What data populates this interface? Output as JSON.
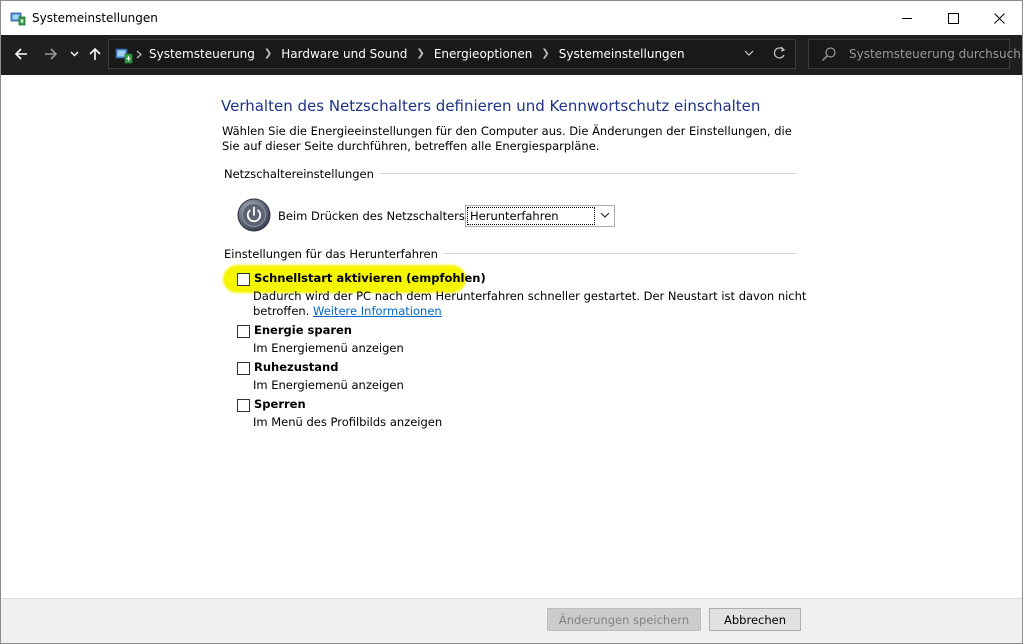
{
  "window": {
    "title": "Systemeinstellungen"
  },
  "address_bar": {
    "breadcrumbs": [
      "Systemsteuerung",
      "Hardware und Sound",
      "Energieoptionen",
      "Systemeinstellungen"
    ],
    "search_placeholder": "Systemsteuerung durchsuch..."
  },
  "page": {
    "title": "Verhalten des Netzschalters definieren und Kennwortschutz einschalten",
    "intro": "Wählen Sie die Energieeinstellungen für den Computer aus. Die Änderungen der Einstellungen, die Sie auf dieser Seite durchführen, betreffen alle Energiesparpläne."
  },
  "power_button_settings": {
    "group_label": "Netzschaltereinstellungen",
    "label": "Beim Drücken des Netzschalters:",
    "selected": "Herunterfahren"
  },
  "shutdown_settings": {
    "group_label": "Einstellungen für das Herunterfahren",
    "options": [
      {
        "title": "Schnellstart aktivieren (empfohlen)",
        "desc_line1": "Dadurch wird der PC nach dem Herunterfahren schneller gestartet. Der Neustart ist davon nicht",
        "desc_line2_prefix": "betroffen.",
        "link": "Weitere Informationen",
        "checked": false,
        "highlighted": true
      },
      {
        "title": "Energie sparen",
        "desc": "Im Energiemenü anzeigen",
        "checked": false
      },
      {
        "title": "Ruhezustand",
        "desc": "Im Energiemenü anzeigen",
        "checked": false
      },
      {
        "title": "Sperren",
        "desc": "Im Menü des Profilbilds anzeigen",
        "checked": false
      }
    ]
  },
  "footer": {
    "save_label": "Änderungen speichern",
    "cancel_label": "Abbrechen"
  },
  "colors": {
    "title_blue": "#1e3287",
    "link_blue": "#0066cc",
    "highlight_yellow": "#f5f500",
    "address_bar_bg": "#1f1f1f"
  },
  "icons": [
    "control-panel-icon",
    "back-arrow-icon",
    "forward-arrow-icon",
    "recent-dropdown-icon",
    "up-arrow-icon",
    "chevron-down-icon",
    "refresh-icon",
    "search-icon",
    "power-icon",
    "minimize-icon",
    "maximize-icon",
    "close-icon"
  ]
}
